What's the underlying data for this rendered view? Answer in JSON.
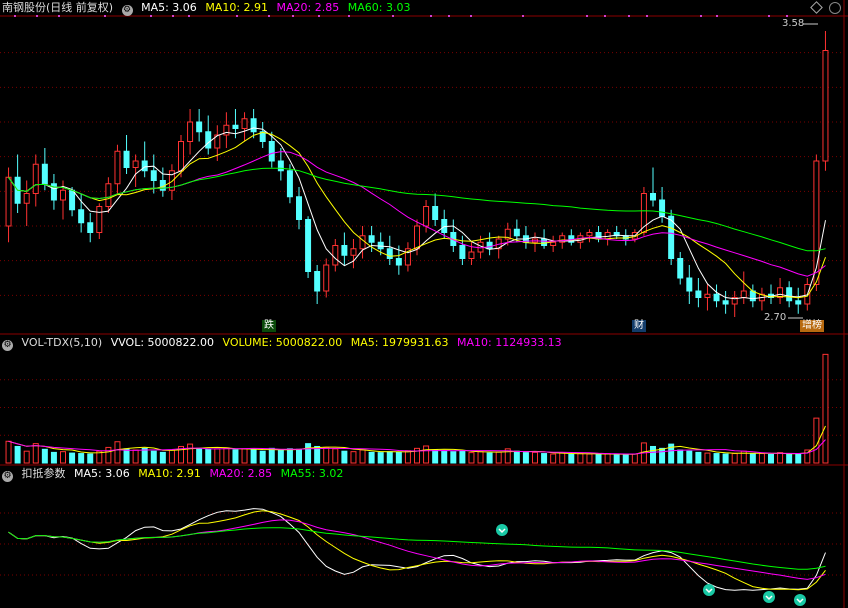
{
  "colors": {
    "up": "#ff3232",
    "down": "#54ffff",
    "ma5": "#ffffff",
    "ma10": "#ffff00",
    "ma20": "#ff00ff",
    "ma60": "#00ff00",
    "grid": "#7a0000",
    "frame": "#8b0000"
  },
  "header": {
    "price": {
      "title": "南钢股份(日线 前复权)",
      "ma5": "MA5: 3.06",
      "ma10": "MA10: 2.91",
      "ma20": "MA20: 2.85",
      "ma60": "MA60: 3.03"
    },
    "volume": {
      "title": "VOL-TDX(5,10)",
      "vvol": "VVOL: 5000822.00",
      "volume": "VOLUME: 5000822.00",
      "ma5": "MA5: 1979931.63",
      "ma10": "MA10: 1124933.13"
    },
    "indicator": {
      "title": "扣抵参数",
      "ma5": "MA5: 3.06",
      "ma10": "MA10: 2.91",
      "ma20": "MA20: 2.85",
      "ma55": "MA55: 3.02"
    }
  },
  "markers": {
    "high": "3.58",
    "low": "2.70",
    "event1": "跌",
    "event2": "财",
    "event3": "增榜"
  },
  "icons": {
    "gear": "gear-icon",
    "scroll": "diamond-scroll-icon",
    "signal": "chevron-down-circle-icon"
  },
  "chart_data": {
    "type": "candlestick",
    "ylim": [
      2.66,
      3.62
    ],
    "candles": [
      [
        2.98,
        3.16,
        2.93,
        3.13
      ],
      [
        3.13,
        3.2,
        3.02,
        3.05
      ],
      [
        3.05,
        3.12,
        2.98,
        3.08
      ],
      [
        3.08,
        3.2,
        3.04,
        3.17
      ],
      [
        3.17,
        3.22,
        3.09,
        3.11
      ],
      [
        3.11,
        3.14,
        3.03,
        3.06
      ],
      [
        3.06,
        3.12,
        3.0,
        3.09
      ],
      [
        3.09,
        3.1,
        3.01,
        3.03
      ],
      [
        3.03,
        3.08,
        2.96,
        2.99
      ],
      [
        2.99,
        3.02,
        2.93,
        2.96
      ],
      [
        2.96,
        3.05,
        2.94,
        3.04
      ],
      [
        3.04,
        3.13,
        3.02,
        3.11
      ],
      [
        3.11,
        3.23,
        3.08,
        3.21
      ],
      [
        3.21,
        3.26,
        3.14,
        3.16
      ],
      [
        3.16,
        3.2,
        3.1,
        3.18
      ],
      [
        3.18,
        3.24,
        3.13,
        3.15
      ],
      [
        3.15,
        3.2,
        3.08,
        3.12
      ],
      [
        3.12,
        3.16,
        3.07,
        3.09
      ],
      [
        3.09,
        3.17,
        3.06,
        3.15
      ],
      [
        3.15,
        3.26,
        3.13,
        3.24
      ],
      [
        3.24,
        3.34,
        3.2,
        3.3
      ],
      [
        3.3,
        3.34,
        3.24,
        3.27
      ],
      [
        3.27,
        3.32,
        3.2,
        3.22
      ],
      [
        3.22,
        3.29,
        3.18,
        3.26
      ],
      [
        3.26,
        3.33,
        3.22,
        3.29
      ],
      [
        3.29,
        3.34,
        3.25,
        3.28
      ],
      [
        3.28,
        3.33,
        3.24,
        3.31
      ],
      [
        3.31,
        3.34,
        3.25,
        3.27
      ],
      [
        3.27,
        3.3,
        3.22,
        3.24
      ],
      [
        3.24,
        3.27,
        3.16,
        3.18
      ],
      [
        3.18,
        3.22,
        3.12,
        3.15
      ],
      [
        3.15,
        3.17,
        3.05,
        3.07
      ],
      [
        3.07,
        3.1,
        2.97,
        3.0
      ],
      [
        3.0,
        3.01,
        2.82,
        2.84
      ],
      [
        2.84,
        2.86,
        2.74,
        2.78
      ],
      [
        2.78,
        2.88,
        2.76,
        2.86
      ],
      [
        2.86,
        2.94,
        2.84,
        2.92
      ],
      [
        2.92,
        2.96,
        2.86,
        2.89
      ],
      [
        2.89,
        2.94,
        2.85,
        2.91
      ],
      [
        2.91,
        2.98,
        2.88,
        2.95
      ],
      [
        2.95,
        2.98,
        2.9,
        2.93
      ],
      [
        2.93,
        2.96,
        2.89,
        2.91
      ],
      [
        2.91,
        2.95,
        2.86,
        2.88
      ],
      [
        2.88,
        2.92,
        2.83,
        2.86
      ],
      [
        2.86,
        2.93,
        2.84,
        2.91
      ],
      [
        2.91,
        3.0,
        2.89,
        2.98
      ],
      [
        2.98,
        3.06,
        2.96,
        3.04
      ],
      [
        3.04,
        3.08,
        2.98,
        3.0
      ],
      [
        3.0,
        3.03,
        2.94,
        2.96
      ],
      [
        2.96,
        3.0,
        2.9,
        2.92
      ],
      [
        2.92,
        2.95,
        2.86,
        2.88
      ],
      [
        2.88,
        2.93,
        2.86,
        2.9
      ],
      [
        2.9,
        2.95,
        2.88,
        2.93
      ],
      [
        2.93,
        2.96,
        2.89,
        2.91
      ],
      [
        2.91,
        2.95,
        2.88,
        2.94
      ],
      [
        2.94,
        2.99,
        2.92,
        2.97
      ],
      [
        2.97,
        3.0,
        2.93,
        2.95
      ],
      [
        2.95,
        2.98,
        2.91,
        2.93
      ],
      [
        2.93,
        2.96,
        2.9,
        2.94
      ],
      [
        2.94,
        2.97,
        2.91,
        2.92
      ],
      [
        2.92,
        2.95,
        2.9,
        2.93
      ],
      [
        2.93,
        2.96,
        2.91,
        2.95
      ],
      [
        2.95,
        2.97,
        2.92,
        2.93
      ],
      [
        2.93,
        2.96,
        2.91,
        2.95
      ],
      [
        2.95,
        2.97,
        2.93,
        2.96
      ],
      [
        2.96,
        2.98,
        2.93,
        2.94
      ],
      [
        2.94,
        2.97,
        2.92,
        2.96
      ],
      [
        2.96,
        2.98,
        2.94,
        2.95
      ],
      [
        2.95,
        2.97,
        2.92,
        2.94
      ],
      [
        2.94,
        2.97,
        2.93,
        2.96
      ],
      [
        2.96,
        3.1,
        2.95,
        3.08
      ],
      [
        3.08,
        3.16,
        3.04,
        3.06
      ],
      [
        3.06,
        3.1,
        2.99,
        3.01
      ],
      [
        3.01,
        3.03,
        2.86,
        2.88
      ],
      [
        2.88,
        2.9,
        2.8,
        2.82
      ],
      [
        2.82,
        2.86,
        2.74,
        2.78
      ],
      [
        2.78,
        2.82,
        2.73,
        2.76
      ],
      [
        2.76,
        2.8,
        2.72,
        2.77
      ],
      [
        2.77,
        2.8,
        2.73,
        2.75
      ],
      [
        2.75,
        2.78,
        2.71,
        2.74
      ],
      [
        2.74,
        2.78,
        2.7,
        2.76
      ],
      [
        2.76,
        2.84,
        2.74,
        2.78
      ],
      [
        2.78,
        2.8,
        2.73,
        2.75
      ],
      [
        2.75,
        2.79,
        2.72,
        2.77
      ],
      [
        2.77,
        2.8,
        2.74,
        2.76
      ],
      [
        2.76,
        2.82,
        2.74,
        2.79
      ],
      [
        2.79,
        2.81,
        2.73,
        2.75
      ],
      [
        2.75,
        2.79,
        2.71,
        2.74
      ],
      [
        2.74,
        2.82,
        2.72,
        2.8
      ],
      [
        2.8,
        3.2,
        2.78,
        3.18
      ],
      [
        3.18,
        3.58,
        3.15,
        3.52
      ]
    ],
    "volumes": [
      [
        0.92,
        1
      ],
      [
        0.7,
        0
      ],
      [
        0.5,
        1
      ],
      [
        0.82,
        1
      ],
      [
        0.58,
        0
      ],
      [
        0.45,
        0
      ],
      [
        0.48,
        1
      ],
      [
        0.42,
        0
      ],
      [
        0.4,
        0
      ],
      [
        0.38,
        0
      ],
      [
        0.5,
        1
      ],
      [
        0.66,
        1
      ],
      [
        0.9,
        1
      ],
      [
        0.6,
        0
      ],
      [
        0.55,
        1
      ],
      [
        0.62,
        0
      ],
      [
        0.5,
        0
      ],
      [
        0.45,
        0
      ],
      [
        0.55,
        1
      ],
      [
        0.7,
        1
      ],
      [
        0.8,
        1
      ],
      [
        0.62,
        0
      ],
      [
        0.58,
        0
      ],
      [
        0.6,
        1
      ],
      [
        0.64,
        1
      ],
      [
        0.56,
        0
      ],
      [
        0.6,
        1
      ],
      [
        0.55,
        0
      ],
      [
        0.5,
        0
      ],
      [
        0.62,
        0
      ],
      [
        0.55,
        0
      ],
      [
        0.6,
        0
      ],
      [
        0.58,
        0
      ],
      [
        0.82,
        0
      ],
      [
        0.7,
        0
      ],
      [
        0.66,
        1
      ],
      [
        0.6,
        1
      ],
      [
        0.5,
        0
      ],
      [
        0.48,
        1
      ],
      [
        0.55,
        1
      ],
      [
        0.45,
        0
      ],
      [
        0.44,
        0
      ],
      [
        0.48,
        0
      ],
      [
        0.45,
        0
      ],
      [
        0.52,
        1
      ],
      [
        0.62,
        1
      ],
      [
        0.72,
        1
      ],
      [
        0.55,
        0
      ],
      [
        0.5,
        0
      ],
      [
        0.48,
        0
      ],
      [
        0.5,
        0
      ],
      [
        0.44,
        1
      ],
      [
        0.48,
        1
      ],
      [
        0.42,
        0
      ],
      [
        0.46,
        1
      ],
      [
        0.6,
        1
      ],
      [
        0.5,
        0
      ],
      [
        0.44,
        0
      ],
      [
        0.45,
        1
      ],
      [
        0.4,
        0
      ],
      [
        0.38,
        1
      ],
      [
        0.42,
        1
      ],
      [
        0.36,
        0
      ],
      [
        0.4,
        1
      ],
      [
        0.38,
        1
      ],
      [
        0.36,
        0
      ],
      [
        0.4,
        1
      ],
      [
        0.35,
        0
      ],
      [
        0.36,
        0
      ],
      [
        0.38,
        1
      ],
      [
        0.85,
        1
      ],
      [
        0.7,
        0
      ],
      [
        0.62,
        0
      ],
      [
        0.8,
        0
      ],
      [
        0.55,
        0
      ],
      [
        0.5,
        0
      ],
      [
        0.45,
        0
      ],
      [
        0.42,
        1
      ],
      [
        0.4,
        0
      ],
      [
        0.38,
        0
      ],
      [
        0.4,
        1
      ],
      [
        0.5,
        1
      ],
      [
        0.38,
        0
      ],
      [
        0.4,
        1
      ],
      [
        0.36,
        0
      ],
      [
        0.44,
        1
      ],
      [
        0.38,
        0
      ],
      [
        0.4,
        0
      ],
      [
        0.55,
        1
      ],
      [
        1.9,
        1
      ],
      [
        4.6,
        1
      ]
    ]
  }
}
